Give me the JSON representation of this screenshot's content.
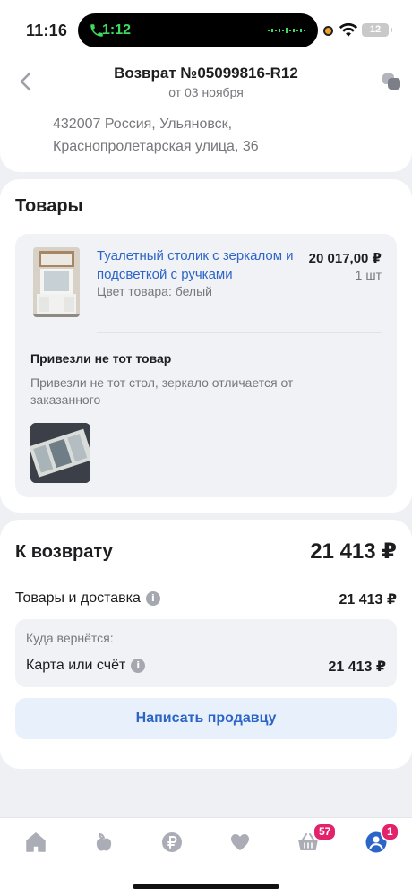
{
  "status": {
    "time": "11:16",
    "call_time": "1:12",
    "battery": "12"
  },
  "header": {
    "title": "Возврат №05099816-R12",
    "subtitle": "от 03 ноября",
    "address_line1": "432007 Россия, Ульяновск,",
    "address_line2": "Краснопролетарская улица, 36"
  },
  "goods": {
    "section_title": "Товары",
    "product": {
      "name": "Туалетный столик с зеркалом и подсветкой с ручками",
      "color": "Цвет товара: белый",
      "price": "20 017,00 ₽",
      "qty": "1 шт"
    },
    "reason_title": "Привезли не тот товар",
    "reason_text": "Привезли не тот стол, зеркало отличается от заказанного"
  },
  "refund": {
    "title": "К возврату",
    "total": "21 413 ₽",
    "items_label": "Товары и доставка",
    "items_value": "21 413 ₽",
    "return_caption": "Куда вернётся:",
    "return_label": "Карта или счёт",
    "return_value": "21 413 ₽",
    "seller_button": "Написать продавцу"
  },
  "tabbar": {
    "items": [
      {
        "icon": "home-icon"
      },
      {
        "icon": "apple-icon"
      },
      {
        "icon": "ruble-icon"
      },
      {
        "icon": "heart-icon"
      },
      {
        "icon": "basket-icon",
        "badge": "57"
      },
      {
        "icon": "profile-icon",
        "badge": "1"
      }
    ],
    "active_color": "#2c64c7",
    "inactive_color": "#aaacb6"
  }
}
